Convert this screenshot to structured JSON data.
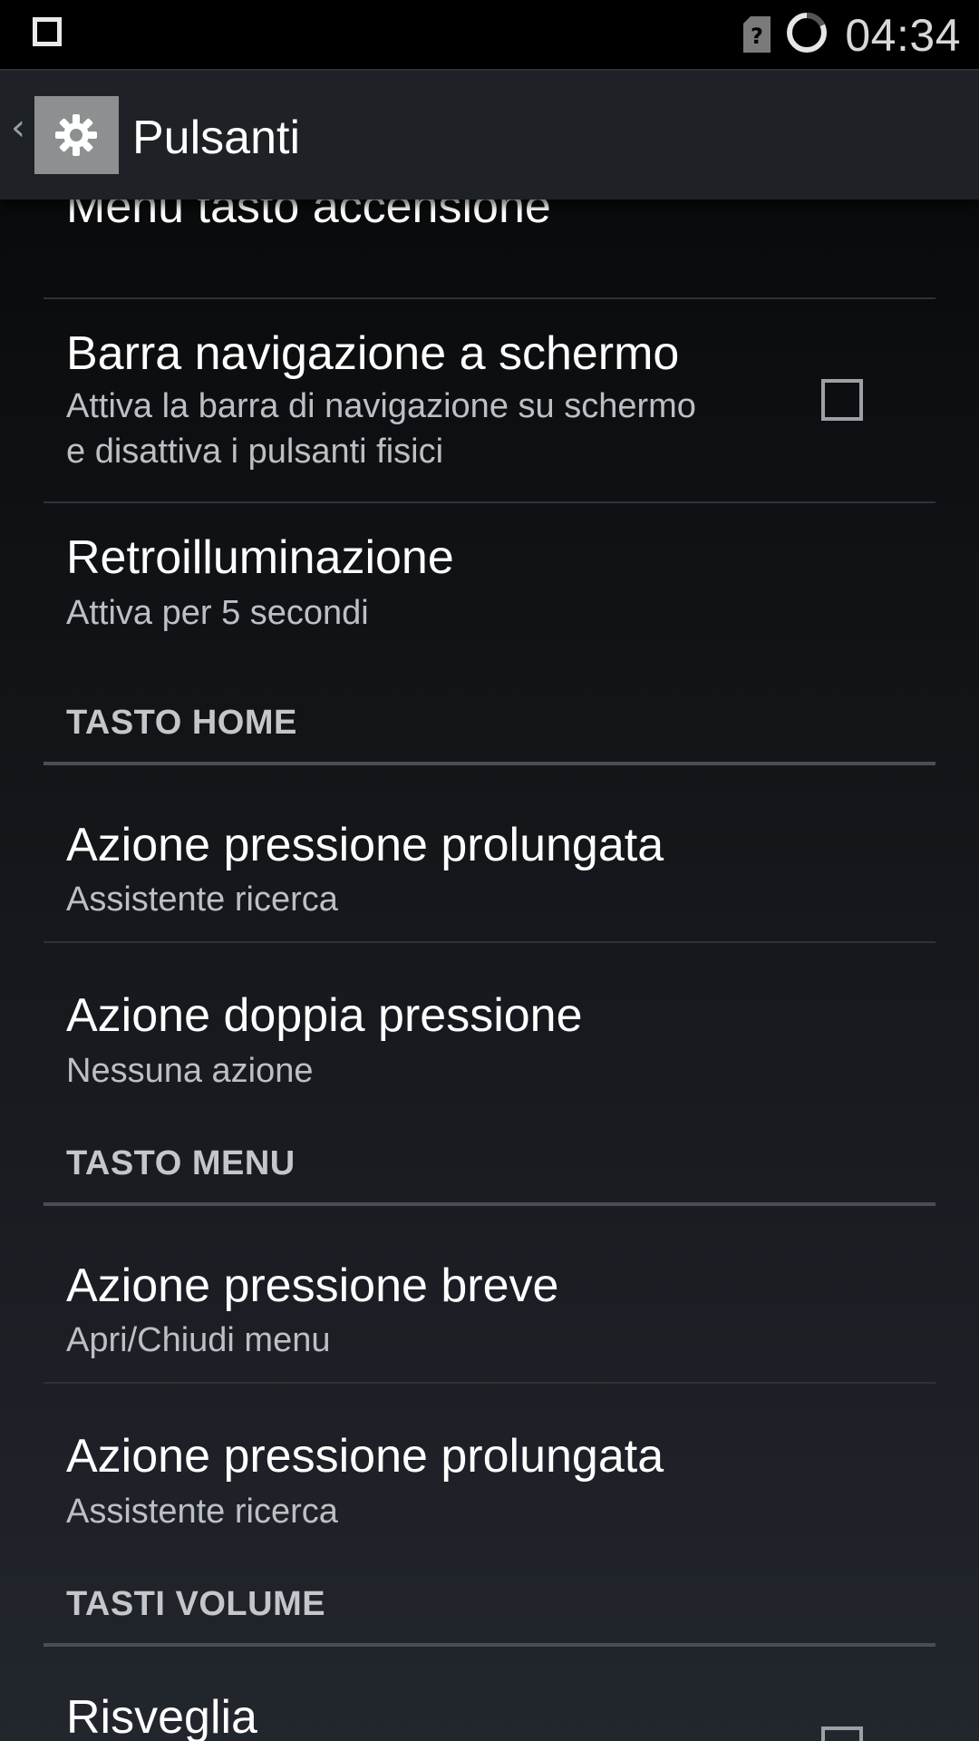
{
  "status_bar": {
    "time": "04:34",
    "icons": [
      "square-notification-icon",
      "sim-unknown-icon",
      "loading-ring-icon"
    ]
  },
  "action_bar": {
    "title": "Pulsanti",
    "icon": "gear-icon",
    "back": "‹"
  },
  "list": {
    "menu_tasto_accensione": "Menu tasto accensione",
    "barra_navigazione": {
      "title": "Barra navigazione a schermo",
      "summary": "Attiva la barra di navigazione su schermo e disattiva i pulsanti fisici",
      "checked": false
    },
    "retroilluminazione": {
      "title": "Retroilluminazione",
      "summary": "Attiva per 5 secondi"
    },
    "sections": {
      "home": "TASTO HOME",
      "menu": "TASTO MENU",
      "volume": "TASTI VOLUME"
    },
    "home_items": [
      {
        "title": "Azione pressione prolungata",
        "summary": "Assistente ricerca"
      },
      {
        "title": "Azione doppia pressione",
        "summary": "Nessuna azione"
      }
    ],
    "menu_items": [
      {
        "title": "Azione pressione breve",
        "summary": "Apri/Chiudi menu"
      },
      {
        "title": "Azione pressione prolungata",
        "summary": "Assistente ricerca"
      }
    ],
    "volume_items": [
      {
        "title": "Risveglia",
        "checked": false
      }
    ]
  },
  "colors": {
    "background_top": "#050607",
    "background_bottom": "#22262d",
    "action_bar": "#1e2226",
    "summary_text": "#bcc0c4",
    "section_text": "#c4c7ca"
  }
}
